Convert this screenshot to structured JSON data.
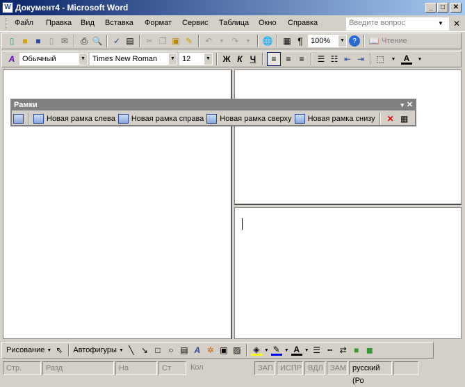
{
  "window": {
    "title": "Документ4 - Microsoft Word",
    "min": "_",
    "max": "□",
    "close": "✕"
  },
  "menu": {
    "items": [
      "Файл",
      "Правка",
      "Вид",
      "Вставка",
      "Формат",
      "Сервис",
      "Таблица",
      "Окно",
      "Справка"
    ],
    "ask_placeholder": "Введите вопрос",
    "close": "✕"
  },
  "standard": {
    "zoom": "100%",
    "reading": "Чтение",
    "pilcrow": "¶"
  },
  "formatting": {
    "style": "Обычный",
    "font": "Times New Roman",
    "size": "12",
    "bold": "Ж",
    "italic": "К",
    "underline": "Ч",
    "font_color_label": "A"
  },
  "frames_toolbar": {
    "title": "Рамки",
    "buttons": [
      "Новая рамка слева",
      "Новая рамка справа",
      "Новая рамка сверху",
      "Новая рамка снизу"
    ],
    "close": "✕",
    "menu": "▾"
  },
  "drawing": {
    "draw": "Рисование",
    "autoshapes": "Автофигуры"
  },
  "status": {
    "cells": [
      "Стр.",
      "Разд",
      "На",
      "Ст",
      "Кол",
      "ЗАП",
      "ИСПР",
      "ВДЛ",
      "ЗАМ",
      "русский (Ро"
    ]
  }
}
